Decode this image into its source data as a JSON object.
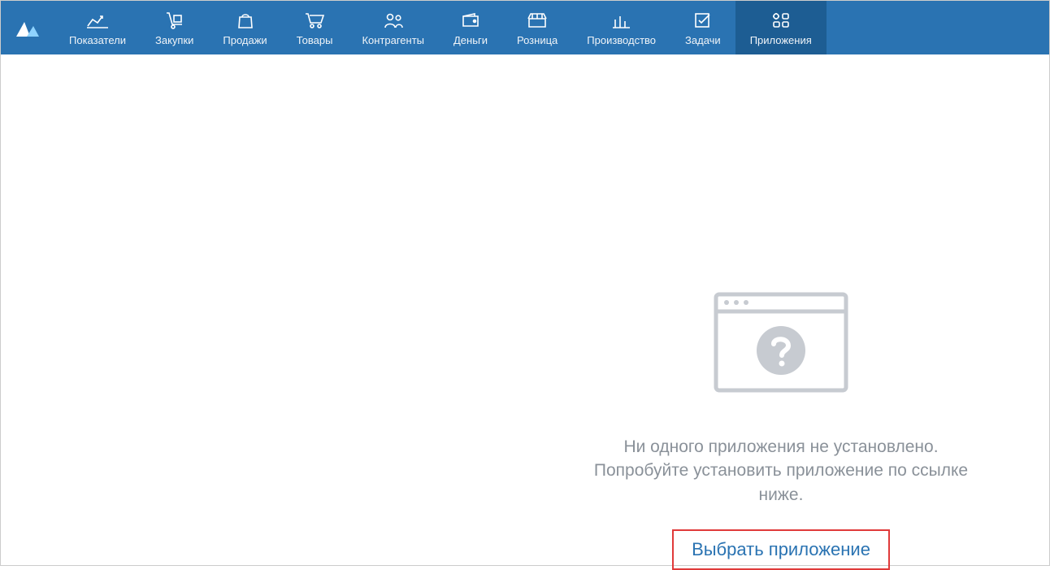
{
  "nav": {
    "items": [
      {
        "id": "indicators",
        "label": "Показатели",
        "active": false
      },
      {
        "id": "purchases",
        "label": "Закупки",
        "active": false
      },
      {
        "id": "sales",
        "label": "Продажи",
        "active": false
      },
      {
        "id": "goods",
        "label": "Товары",
        "active": false
      },
      {
        "id": "counterparties",
        "label": "Контрагенты",
        "active": false
      },
      {
        "id": "money",
        "label": "Деньги",
        "active": false
      },
      {
        "id": "retail",
        "label": "Розница",
        "active": false
      },
      {
        "id": "production",
        "label": "Производство",
        "active": false
      },
      {
        "id": "tasks",
        "label": "Задачи",
        "active": false
      },
      {
        "id": "apps",
        "label": "Приложения",
        "active": true
      }
    ]
  },
  "empty": {
    "line1": "Ни одного приложения не установлено.",
    "line2": "Попробуйте установить приложение по ссылке ниже.",
    "action": "Выбрать приложение"
  },
  "colors": {
    "navBg": "#2a73b2",
    "navActiveBg": "#1d5d93",
    "textMuted": "#8a9199",
    "actionBorder": "#e03a3a"
  }
}
